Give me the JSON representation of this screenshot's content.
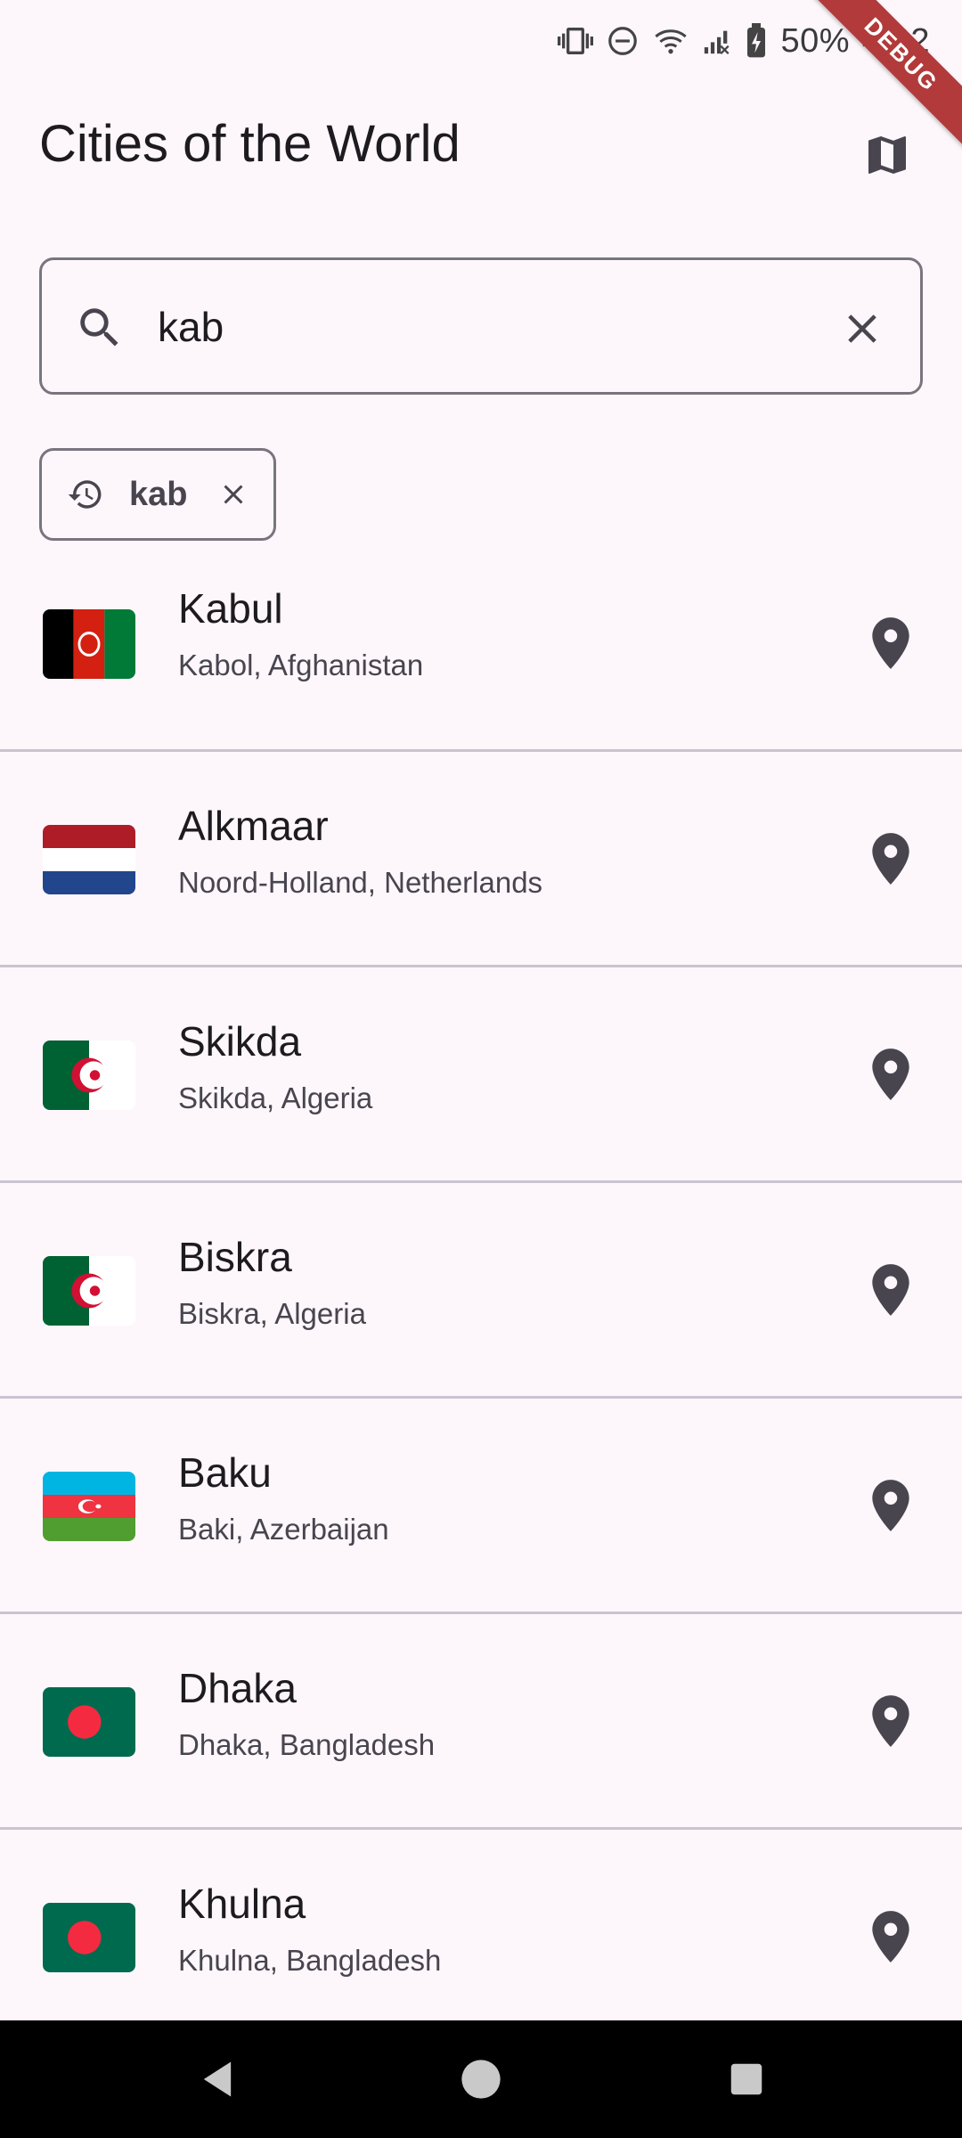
{
  "status_bar": {
    "battery": "50%",
    "time": "4:02",
    "icons": [
      "vibrate-icon",
      "dnd-icon",
      "wifi-icon",
      "signal-icon",
      "battery-icon"
    ],
    "debug_banner": "DEBUG"
  },
  "header": {
    "title": "Cities of the World",
    "map_icon": "map-icon"
  },
  "search": {
    "value": "kab",
    "icon": "search-icon",
    "clear_icon": "close-icon"
  },
  "history": {
    "chips": [
      {
        "label": "kab",
        "icon": "history-icon",
        "remove_icon": "close-icon"
      }
    ]
  },
  "cities": [
    {
      "name": "Kabul",
      "region": "Kabol, Afghanistan",
      "flag": "afghanistan-flag-icon"
    },
    {
      "name": "Alkmaar",
      "region": "Noord-Holland, Netherlands",
      "flag": "netherlands-flag-icon"
    },
    {
      "name": "Skikda",
      "region": "Skikda, Algeria",
      "flag": "algeria-flag-icon"
    },
    {
      "name": "Biskra",
      "region": "Biskra, Algeria",
      "flag": "algeria-flag-icon"
    },
    {
      "name": "Baku",
      "region": "Baki, Azerbaijan",
      "flag": "azerbaijan-flag-icon"
    },
    {
      "name": "Dhaka",
      "region": "Dhaka, Bangladesh",
      "flag": "bangladesh-flag-icon"
    },
    {
      "name": "Khulna",
      "region": "Khulna, Bangladesh",
      "flag": "bangladesh-flag-icon"
    }
  ],
  "colors": {
    "background": "#fdf7fc",
    "outline": "#79747e",
    "divider": "#cac4d0",
    "icon": "#49454f",
    "debug_banner": "#b23a3a"
  },
  "nav_bar": {
    "buttons": [
      "back-icon",
      "home-icon",
      "recents-icon"
    ]
  }
}
